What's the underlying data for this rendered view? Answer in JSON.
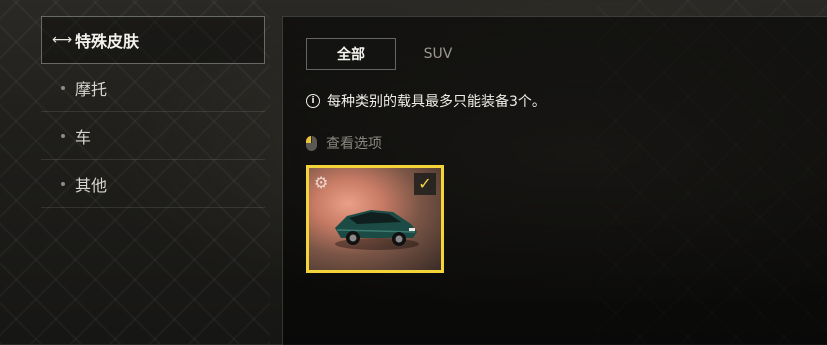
{
  "sidebar": {
    "items": [
      {
        "label": "特殊皮肤",
        "active": true,
        "icon": "swap-arrows-icon"
      },
      {
        "label": "摩托",
        "active": false
      },
      {
        "label": "车",
        "active": false
      },
      {
        "label": "其他",
        "active": false
      }
    ]
  },
  "tabs": [
    {
      "label": "全部",
      "active": true
    },
    {
      "label": "SUV",
      "active": false
    }
  ],
  "notice": {
    "icon": "info-icon",
    "text": "每种类别的载具最多只能装备3个。"
  },
  "view_options": {
    "icon": "mouse-icon",
    "label": "查看选项"
  },
  "skin_card": {
    "selected": true,
    "equipped": true,
    "badge_icon": "gear-icon",
    "check_icon": "checkmark-icon",
    "item": "car-image",
    "colors": {
      "border": "#f3d53a",
      "car": "#1c4a44"
    }
  }
}
